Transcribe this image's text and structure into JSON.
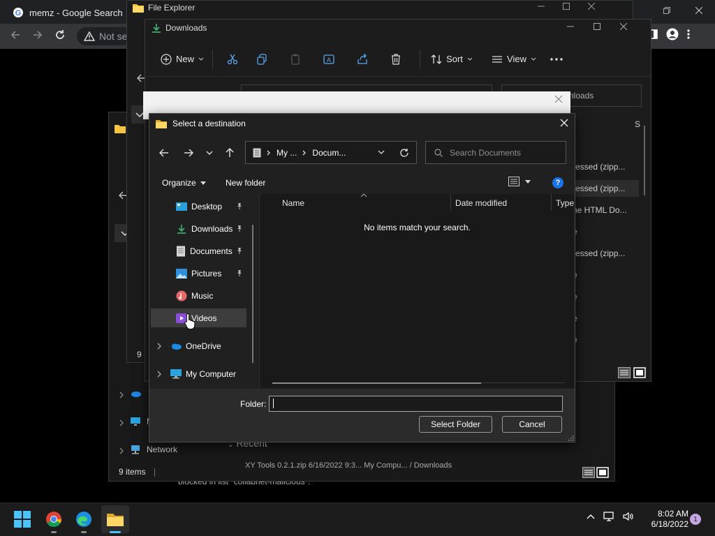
{
  "chrome": {
    "tab_title": "memz - Google Search",
    "omnibox_text": "Not se"
  },
  "background_banner": "blocked in list \"collabnet-malicious\".",
  "explorer_back": {
    "title": "File Explorer",
    "sidebar": [
      "M",
      "Network"
    ],
    "status": "9 items",
    "status_short": "9",
    "recent_label": "Recent",
    "recent_file": "XY Tools 0.2.1.zip      6/16/2022 9:3...    My Compu...  / Downloads"
  },
  "explorer_downloads": {
    "title": "Downloads",
    "toolbar": {
      "new_label": "New",
      "sort_label": "Sort",
      "view_label": "View"
    },
    "search_suffix": "nloads",
    "col_s": "S",
    "files": [
      "ressed (zipp...",
      "ressed (zipp...",
      "ne HTML Do...",
      "e",
      "ressed (zipp...",
      "e",
      "e",
      "e",
      "e"
    ]
  },
  "dialog": {
    "title": "Select a destination",
    "breadcrumb": [
      "My ...",
      "Docum..."
    ],
    "search_placeholder": "Search Documents",
    "organize_label": "Organize",
    "new_folder_label": "New folder",
    "help_label": "?",
    "nav_items": [
      {
        "label": "Desktop",
        "pinned": true
      },
      {
        "label": "Downloads",
        "pinned": true
      },
      {
        "label": "Documents",
        "pinned": true
      },
      {
        "label": "Pictures",
        "pinned": true
      },
      {
        "label": "Music",
        "pinned": false
      },
      {
        "label": "Videos",
        "pinned": false
      },
      {
        "label": "OneDrive",
        "pinned": false
      },
      {
        "label": "My Computer",
        "pinned": false
      }
    ],
    "columns": [
      "Name",
      "Date modified",
      "Type"
    ],
    "empty_message": "No items match your search.",
    "folder_label": "Folder:",
    "folder_value": "",
    "select_button": "Select Folder",
    "cancel_button": "Cancel"
  },
  "taskbar": {
    "time": "8:02 AM",
    "date": "6/18/2022",
    "notification_count": "1"
  },
  "colors": {
    "accent_blue": "#1a73e8",
    "folder_yellow": "#f5c542",
    "download_green": "#3fb77a"
  }
}
